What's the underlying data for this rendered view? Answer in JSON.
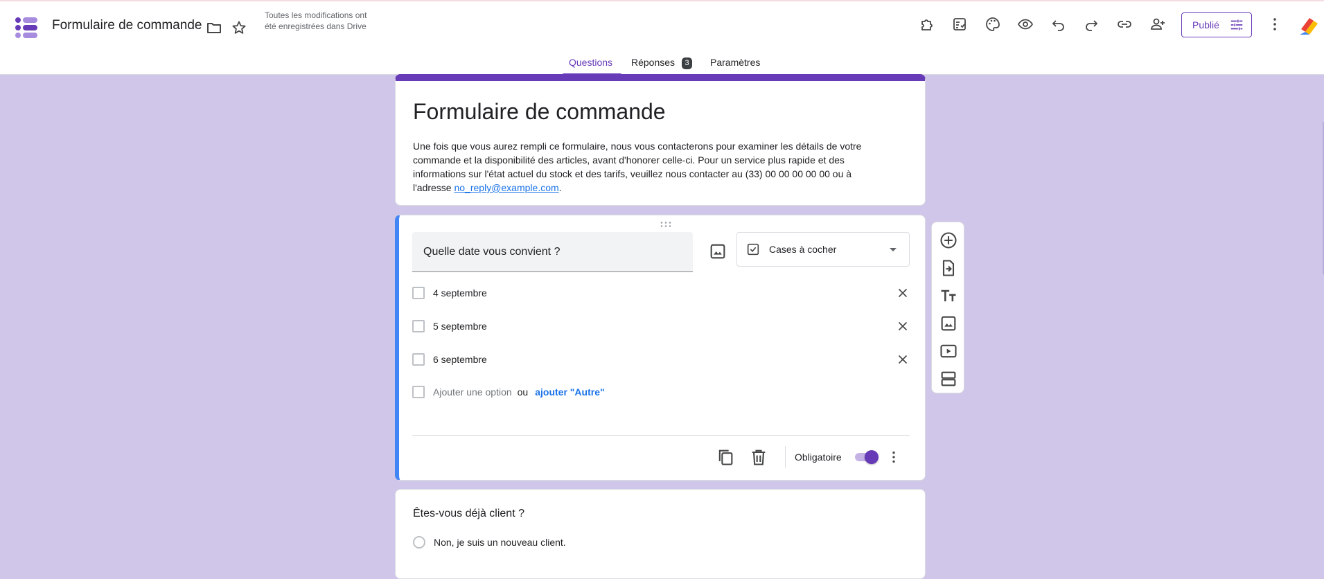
{
  "header": {
    "doc_title": "Formulaire de commande",
    "save_status": "Toutes les modifications ont été enregistrées dans Drive",
    "publish_label": "Publié",
    "icons": [
      "folder-icon",
      "star-icon",
      "addon-icon",
      "quiz-icon",
      "palette-icon",
      "preview-icon",
      "undo-icon",
      "redo-icon",
      "link-icon",
      "add-collaborator-icon",
      "more-vert-icon"
    ]
  },
  "tabs": {
    "questions": "Questions",
    "responses": "Réponses",
    "responses_count": "3",
    "settings": "Paramètres"
  },
  "form": {
    "title": "Formulaire de commande",
    "description_text": "Une fois que vous aurez rempli ce formulaire, nous vous contacterons pour examiner les détails de votre commande et la disponibilité des articles, avant d'honorer celle-ci. Pour un service plus rapide et des informations sur l'état actuel du stock et des tarifs, veuillez nous contacter au (33) 00 00 00 00 00 ou à l'adresse",
    "email": "no_reply@example.com",
    "desc_end": "."
  },
  "question1": {
    "title": "Quelle date vous convient ?",
    "type": "Cases à cocher",
    "options": [
      "4 septembre",
      "5 septembre",
      "6 septembre"
    ],
    "add_option": "Ajouter une option",
    "or_text": "ou",
    "add_other": "ajouter \"Autre\"",
    "required_label": "Obligatoire",
    "required": true
  },
  "question2": {
    "title": "Êtes-vous déjà client ?",
    "options": [
      "Non, je suis un nouveau client."
    ]
  },
  "side_toolbar": [
    "add-question-icon",
    "import-questions-icon",
    "add-title-icon",
    "add-image-icon",
    "add-video-icon",
    "add-section-icon"
  ],
  "colors": {
    "accent": "#673ab7",
    "background": "#d0c6e9",
    "active_question_border": "#4285f4",
    "link": "#1a73e8"
  }
}
